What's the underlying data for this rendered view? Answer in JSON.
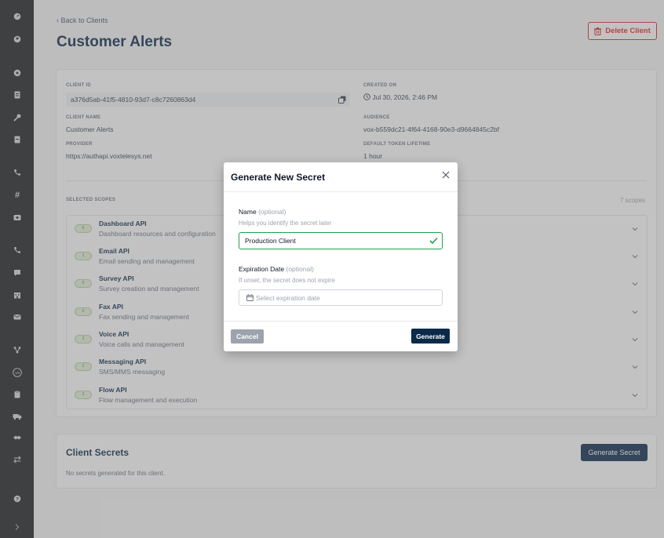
{
  "sidebar": {
    "icons": [
      "dashboard-icon",
      "user-circle-icon",
      "settings-circle-icon",
      "document-icon",
      "key-icon",
      "file-icon",
      "phone-icon",
      "hash-icon",
      "inbox-icon",
      "phone-outgoing-icon",
      "message-icon",
      "building-icon",
      "mail-icon",
      "flow-icon",
      "scale-icon",
      "clipboard-icon",
      "truck-icon",
      "link-icon",
      "transfer-icon",
      "help-icon",
      "chevron-right-icon"
    ]
  },
  "header": {
    "back_label": "Back to Clients",
    "title": "Customer Alerts",
    "delete_label": "Delete Client"
  },
  "details": {
    "client_id_label": "CLIENT ID",
    "client_id": "a376d5ab-41f5-4810-93d7-c8c7260863d4",
    "created_on_label": "CREATED ON",
    "created_on": "Jul 30, 2026, 2:46 PM",
    "client_name_label": "CLIENT NAME",
    "client_name": "Customer Alerts",
    "audience_label": "AUDIENCE",
    "audience": "vox-b559dc21-4f64-4168-90e3-d9664845c2bf",
    "provider_label": "PROVIDER",
    "provider": "https://authapi.voxtelesys.net",
    "token_lifetime_label": "DEFAULT TOKEN LIFETIME",
    "token_lifetime": "1 hour"
  },
  "scopes": {
    "label": "SELECTED SCOPES",
    "count": "7 scopes",
    "items": [
      {
        "toggle": "0",
        "name": "Dashboard API",
        "desc": "Dashboard resources and configuration"
      },
      {
        "toggle": "1",
        "name": "Email API",
        "desc": "Email sending and management"
      },
      {
        "toggle": "0",
        "name": "Survey API",
        "desc": "Survey creation and management"
      },
      {
        "toggle": "0",
        "name": "Fax API",
        "desc": "Fax sending and management"
      },
      {
        "toggle": "2",
        "name": "Voice API",
        "desc": "Voice calls and management"
      },
      {
        "toggle": "2",
        "name": "Messaging API",
        "desc": "SMS/MMS messaging"
      },
      {
        "toggle": "2",
        "name": "Flow API",
        "desc": "Flow management and execution"
      }
    ]
  },
  "secrets": {
    "title": "Client Secrets",
    "empty": "No secrets generated for this client.",
    "generate_label": "Generate Secret"
  },
  "modal": {
    "title": "Generate New Secret",
    "name_label": "Name",
    "optional": "(optional)",
    "name_help": "Helps you identify the secret later",
    "name_value": "Production Client",
    "exp_label": "Expiration Date",
    "exp_help": "If unset, the secret does not expire",
    "exp_placeholder": "Select expiration date",
    "cancel_label": "Cancel",
    "generate_label": "Generate"
  },
  "colors": {
    "brand": "#0b2a4a",
    "danger": "#dc2626",
    "success": "#22a04b",
    "sidebar": "#1c1f24"
  }
}
